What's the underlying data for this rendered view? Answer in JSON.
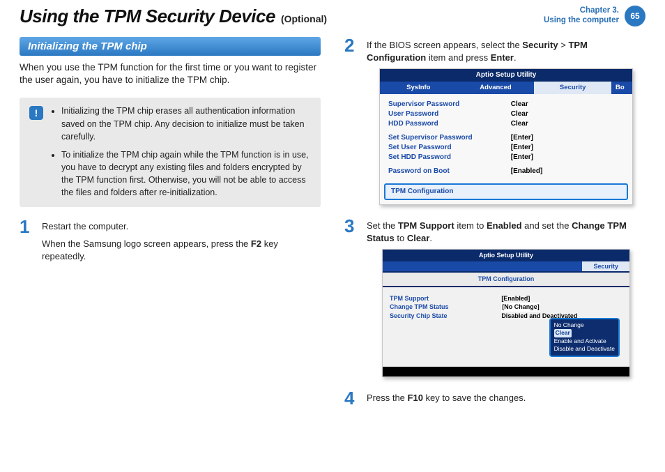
{
  "header": {
    "title": "Using the TPM Security Device",
    "subtitle": "(Optional)",
    "chapter_line1": "Chapter 3.",
    "chapter_line2": "Using the computer",
    "page_number": "65"
  },
  "left": {
    "section_heading": "Initializing the TPM chip",
    "intro": "When you use the TPM function for the first time or you want to register the user again, you have to initialize the TPM chip.",
    "warning_badge": "!",
    "warning_items": [
      "Initializing the TPM chip erases all authentication information saved on the TPM chip. Any decision to initialize must be taken carefully.",
      "To initialize the TPM chip again while the TPM function is in use, you have to decrypt any existing files and folders encrypted by the TPM function first. Otherwise, you will not be able to access the files and folders after re-initialization."
    ],
    "step1_number": "1",
    "step1_line1": "Restart the computer.",
    "step1_line2a": "When the Samsung logo screen appears, press the ",
    "step1_line2b": "F2",
    "step1_line2c": " key repeatedly."
  },
  "right": {
    "step2_number": "2",
    "step2_a": "If the BIOS screen appears, select the ",
    "step2_b": "Security",
    "step2_c": " > ",
    "step2_d": "TPM Configuration",
    "step2_e": " item and press ",
    "step2_f": "Enter",
    "step2_g": ".",
    "bios1": {
      "title": "Aptio Setup Utility",
      "tabs": {
        "t1": "SysInfo",
        "t2": "Advanced",
        "t3": "Security",
        "t4": "Bo"
      },
      "r1l": "Supervisor Password",
      "r1v": "Clear",
      "r2l": "User Password",
      "r2v": "Clear",
      "r3l": "HDD Password",
      "r3v": "Clear",
      "r4l": "Set Supervisor Password",
      "r4v": "[Enter]",
      "r5l": "Set User Password",
      "r5v": "[Enter]",
      "r6l": "Set HDD Password",
      "r6v": "[Enter]",
      "r7l": "Password on Boot",
      "r7v": "[Enabled]",
      "selected": "TPM Configuration"
    },
    "step3_number": "3",
    "step3_a": "Set the ",
    "step3_b": "TPM Support",
    "step3_c": " item to ",
    "step3_d": "Enabled",
    "step3_e": " and set the ",
    "step3_f": "Change TPM Status",
    "step3_g": " to ",
    "step3_h": "Clear",
    "step3_i": ".",
    "bios2": {
      "title": "Aptio Setup Utility",
      "tab": "Security",
      "conf": "TPM Configuration",
      "r1l": "TPM Support",
      "r1v": "[Enabled]",
      "r2l": "Change TPM Status",
      "r2v": "[No Change]",
      "r3l": "Security Chip State",
      "r3v": "Disabled and Deactivated",
      "menu": {
        "m1": "No Change",
        "m2": "Clear",
        "m3": "Enable and Activate",
        "m4": "Disable and Deactivate"
      }
    },
    "step4_number": "4",
    "step4_a": "Press the ",
    "step4_b": "F10",
    "step4_c": " key to save the changes."
  }
}
